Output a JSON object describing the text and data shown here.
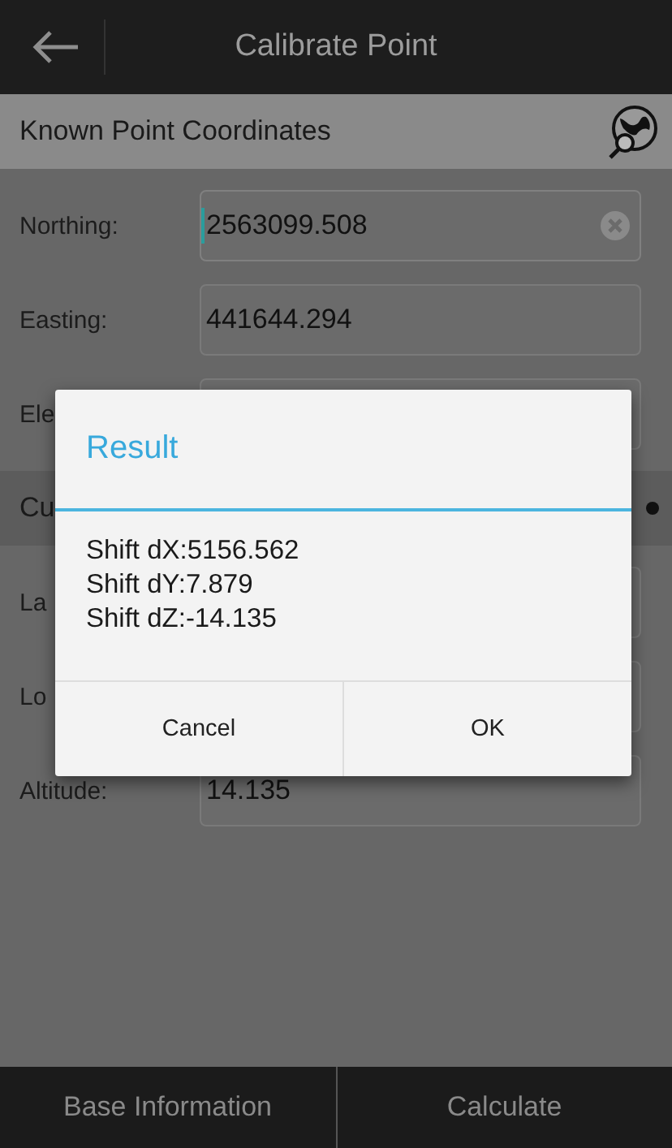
{
  "app_bar": {
    "title": "Calibrate Point"
  },
  "sections": [
    {
      "title": "Known Point Coordinates",
      "fields": [
        {
          "label": "Northing:",
          "value": "2563099.508",
          "focused": true
        },
        {
          "label": "Easting:",
          "value": "441644.294",
          "focused": false
        },
        {
          "label": "Ele"
        }
      ]
    },
    {
      "title": "Cu",
      "fields": [
        {
          "label": "La"
        },
        {
          "label": "Lo"
        },
        {
          "label": "Altitude:",
          "value": "14.135",
          "focused": false
        }
      ]
    }
  ],
  "dialog": {
    "title": "Result",
    "lines": [
      "Shift dX:5156.562",
      "Shift dY:7.879",
      "Shift dZ:-14.135"
    ],
    "buttons": [
      "Cancel",
      "OK"
    ]
  },
  "bottom_bar": {
    "buttons": [
      "Base Information",
      "Calculate"
    ]
  }
}
